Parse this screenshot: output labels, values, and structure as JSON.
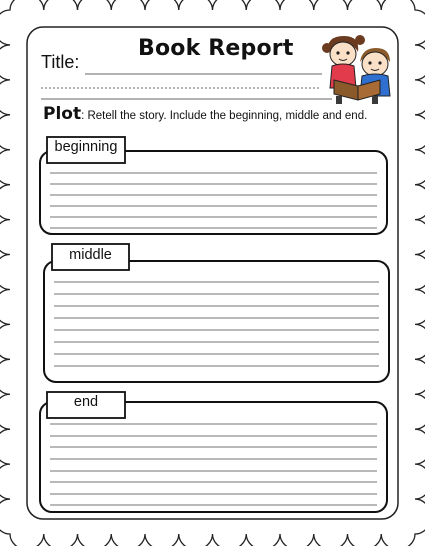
{
  "heading": "Book Report",
  "title_label": "Title:",
  "plot": {
    "word": "Plot",
    "instruction": ": Retell the story. Include the beginning, middle and end."
  },
  "sections": [
    {
      "label": "beginning"
    },
    {
      "label": "middle"
    },
    {
      "label": "end"
    }
  ],
  "illustration": {
    "icon": "reading-kids-icon"
  }
}
